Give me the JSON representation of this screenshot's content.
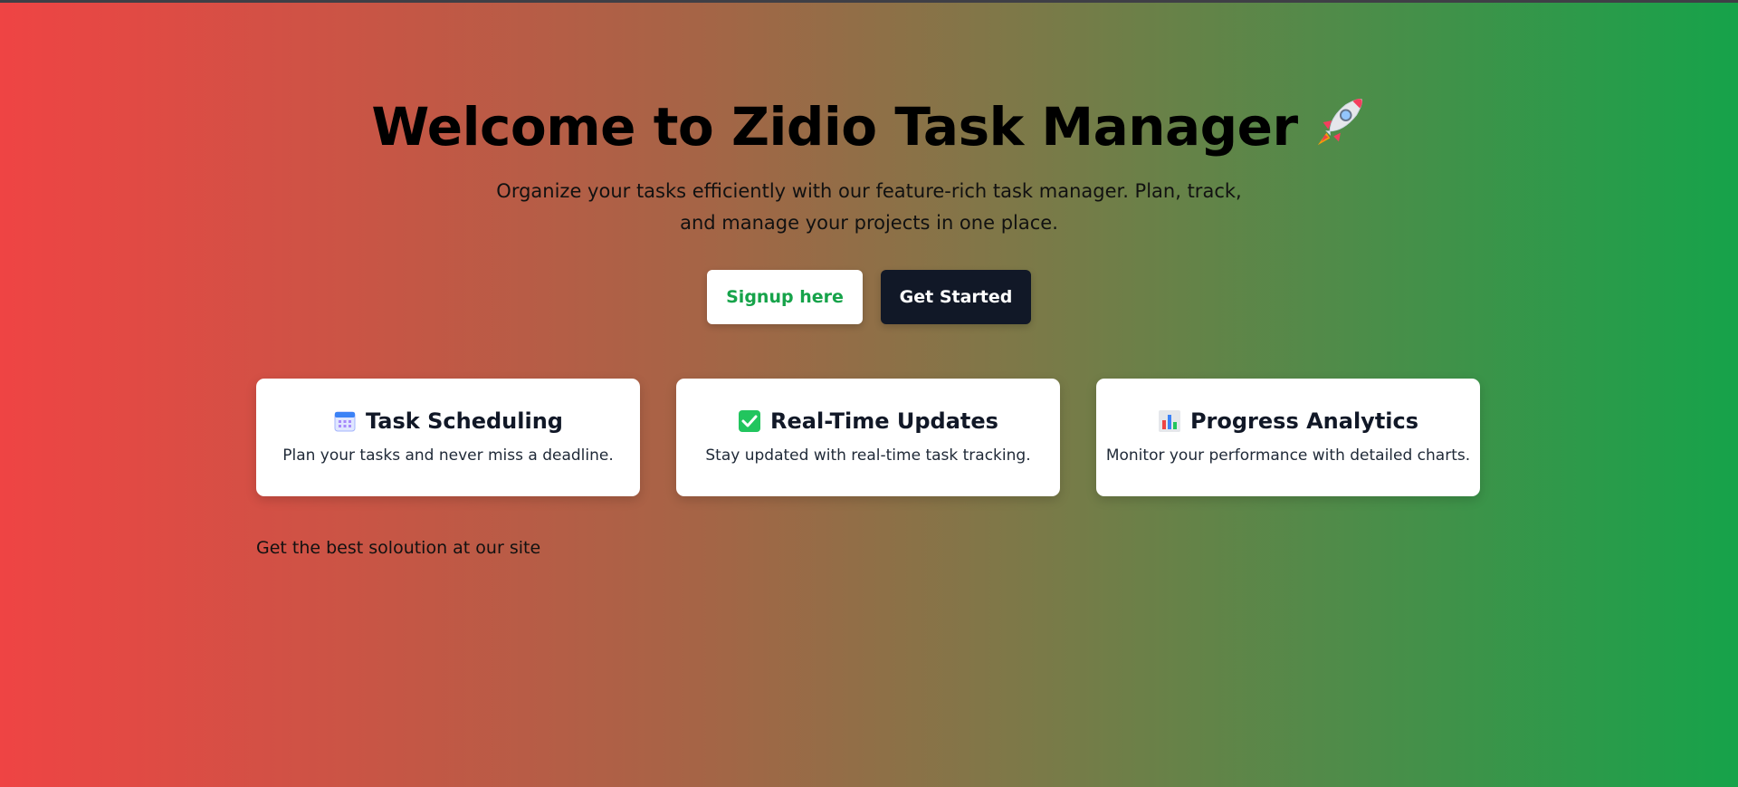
{
  "hero": {
    "title": "Welcome to Zidio Task Manager",
    "title_icon": "rocket-icon",
    "subtitle": "Organize your tasks efficiently with our feature-rich task manager. Plan, track, and manage your projects in one place."
  },
  "buttons": {
    "signup_label": "Signup here",
    "get_started_label": "Get Started"
  },
  "features": [
    {
      "icon": "calendar-icon",
      "title": "Task Scheduling",
      "description": "Plan your tasks and never miss a deadline."
    },
    {
      "icon": "check-mark-icon",
      "title": "Real-Time Updates",
      "description": "Stay updated with real-time task tracking."
    },
    {
      "icon": "bar-chart-icon",
      "title": "Progress Analytics",
      "description": "Monitor your performance with detailed charts."
    }
  ],
  "footer": {
    "text": "Get the best soloution at our site"
  },
  "colors": {
    "gradient_start": "#ef4444",
    "gradient_end": "#16a34a",
    "signup_text": "#16a34a",
    "get_started_bg": "#111827",
    "card_bg": "#ffffff"
  }
}
